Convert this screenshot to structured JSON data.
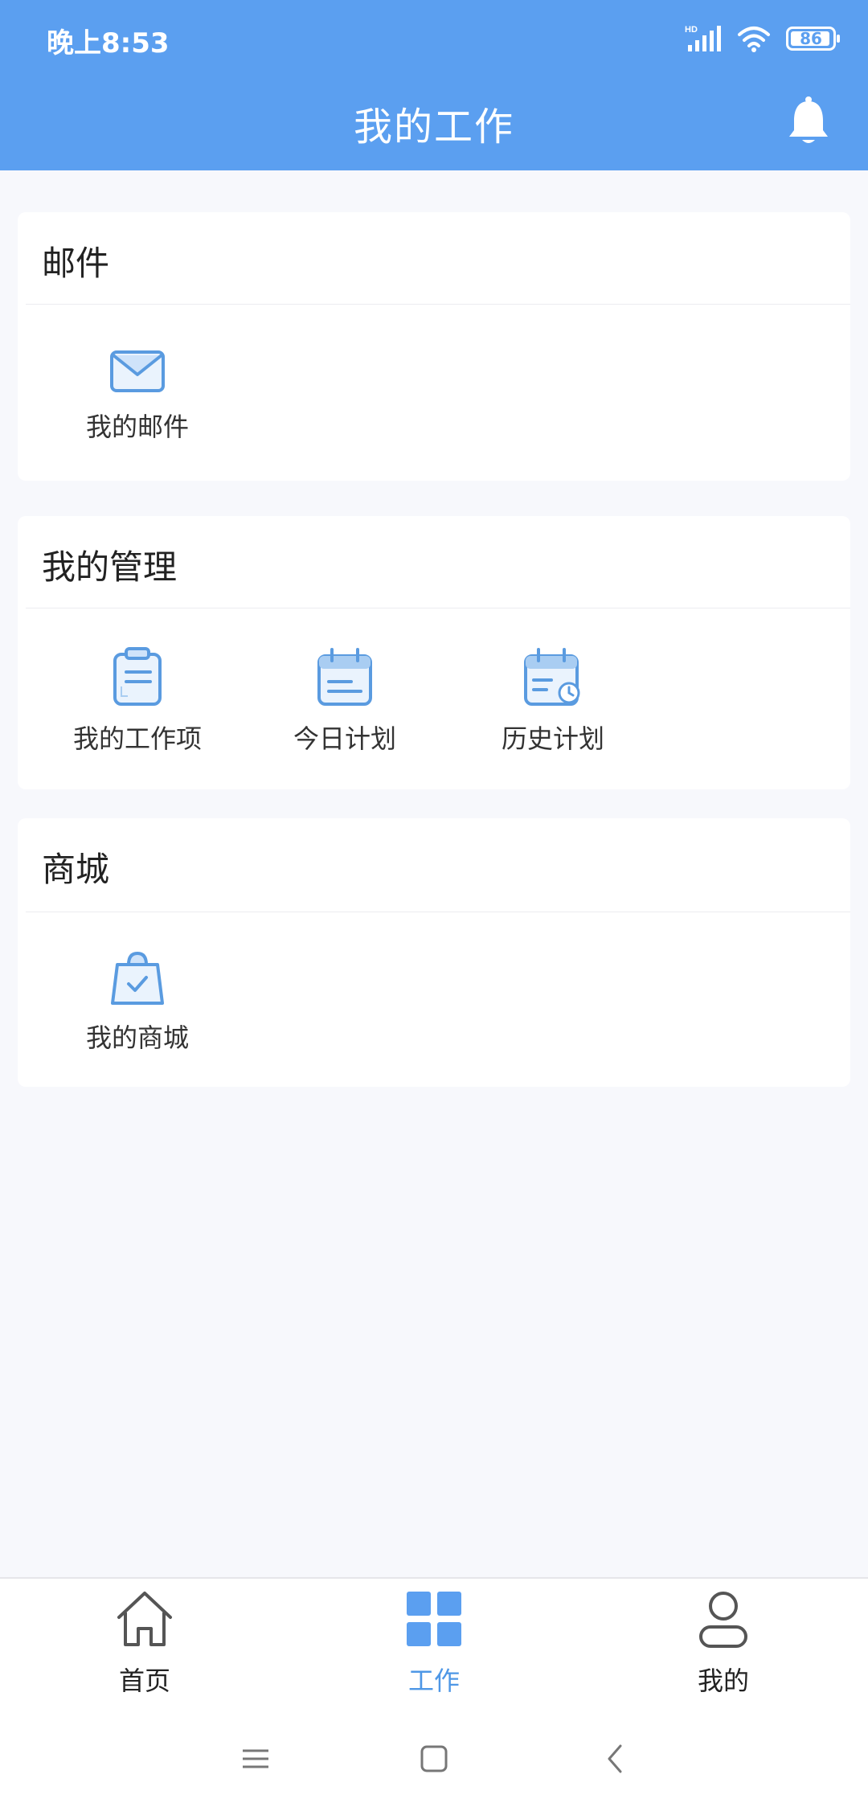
{
  "status_bar": {
    "time": "晚上8:53",
    "battery": "86",
    "signal_label": "HD"
  },
  "header": {
    "title": "我的工作"
  },
  "sections": [
    {
      "title": "邮件",
      "items": [
        {
          "label": "我的邮件",
          "icon": "mail-icon"
        }
      ]
    },
    {
      "title": "我的管理",
      "items": [
        {
          "label": "我的工作项",
          "icon": "clipboard-icon"
        },
        {
          "label": "今日计划",
          "icon": "calendar-icon"
        },
        {
          "label": "历史计划",
          "icon": "calendar-clock-icon"
        }
      ]
    },
    {
      "title": "商城",
      "items": [
        {
          "label": "我的商城",
          "icon": "shopping-bag-icon"
        }
      ]
    }
  ],
  "bottom_nav": [
    {
      "label": "首页",
      "icon": "home-icon"
    },
    {
      "label": "工作",
      "icon": "grid-icon",
      "active": true
    },
    {
      "label": "我的",
      "icon": "user-icon"
    }
  ],
  "colors": {
    "brand": "#5b9ff0",
    "icon": "#5a9be0",
    "active": "#4e97e6"
  }
}
